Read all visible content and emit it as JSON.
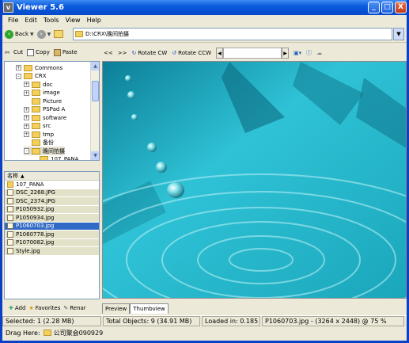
{
  "window": {
    "title": "Viewer 5.6",
    "icon_text": "V"
  },
  "titlebar_buttons": {
    "minimize": "_",
    "maximize": "□",
    "close": "X"
  },
  "menu": [
    "File",
    "Edit",
    "Tools",
    "View",
    "Help"
  ],
  "nav": {
    "back": "Back",
    "address": "D:\\CRX\\晚间拍摄"
  },
  "toolbar": {
    "cut": "Cut",
    "copy": "Copy",
    "paste": "Paste"
  },
  "tree": [
    {
      "label": "Commons",
      "indent": 0,
      "exp": "+",
      "sel": false
    },
    {
      "label": "CRX",
      "indent": 0,
      "exp": "-",
      "sel": false
    },
    {
      "label": "doc",
      "indent": 1,
      "exp": "+",
      "sel": false
    },
    {
      "label": "image",
      "indent": 1,
      "exp": "+",
      "sel": false
    },
    {
      "label": "Picture",
      "indent": 1,
      "exp": "",
      "sel": false
    },
    {
      "label": "PSPad A",
      "indent": 1,
      "exp": "+",
      "sel": false
    },
    {
      "label": "software",
      "indent": 1,
      "exp": "+",
      "sel": false
    },
    {
      "label": "src",
      "indent": 1,
      "exp": "+",
      "sel": false
    },
    {
      "label": "tmp",
      "indent": 1,
      "exp": "+",
      "sel": false
    },
    {
      "label": "备份",
      "indent": 1,
      "exp": "",
      "sel": false
    },
    {
      "label": "晚间拍摄",
      "indent": 1,
      "exp": "-",
      "sel": true
    },
    {
      "label": "107_PANA",
      "indent": 2,
      "exp": "",
      "sel": false
    }
  ],
  "filelist": {
    "header": "名称",
    "files": [
      {
        "name": "107_PANA",
        "type": "folder",
        "sel": false
      },
      {
        "name": "DSC_2268.JPG",
        "type": "file",
        "sel": false
      },
      {
        "name": "DSC_2374.JPG",
        "type": "file",
        "sel": false
      },
      {
        "name": "P1050932.jpg",
        "type": "file",
        "sel": false
      },
      {
        "name": "P1050934.jpg",
        "type": "file",
        "sel": false
      },
      {
        "name": "P1060703.jpg",
        "type": "file",
        "sel": true
      },
      {
        "name": "P1060778.jpg",
        "type": "file",
        "sel": false
      },
      {
        "name": "P1070082.jpg",
        "type": "file",
        "sel": false
      },
      {
        "name": "Style.jpg",
        "type": "file",
        "sel": false
      }
    ]
  },
  "lefttabs": {
    "add": "Add",
    "favorites": "Favorites",
    "rename": "Renar"
  },
  "viewer_toolbar": {
    "prev": "<<",
    "next": ">>",
    "rotate_cw": "Rotate CW",
    "rotate_ccw": "Rotate CCW"
  },
  "viewer_tabs": {
    "preview": "Preview",
    "thumbview": "Thumbview"
  },
  "status": {
    "selected": "Selected: 1 (2.28 MB)",
    "total": "Total Objects: 9 (34.91 MB)",
    "loaded": "Loaded in: 0.185 s",
    "info": "P1060703.jpg - (3264 x 2448) @ 75  %",
    "drag": "Drag Here:",
    "drag_target": "公司聚会090929"
  },
  "colors": {
    "accent": "#0a3fc8",
    "selection": "#316ac5",
    "image_water": "#24b3c6"
  }
}
